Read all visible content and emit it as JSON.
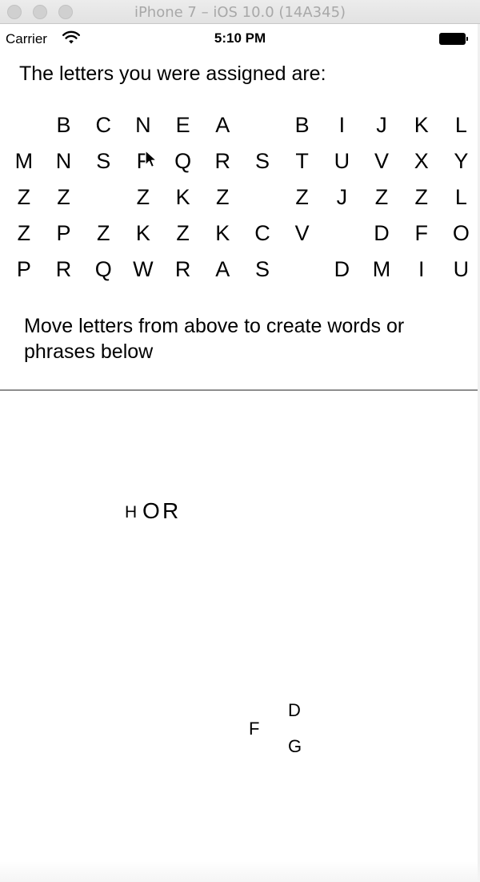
{
  "window": {
    "title": "iPhone 7 – iOS 10.0 (14A345)"
  },
  "statusbar": {
    "carrier": "Carrier",
    "time": "5:10 PM",
    "wifi_icon": "wifi-icon",
    "battery_icon": "battery-icon"
  },
  "assigned": {
    "heading": "The letters you were assigned are:",
    "letters": [
      "",
      "B",
      "C",
      "N",
      "E",
      "A",
      "",
      "B",
      "I",
      "J",
      "K",
      "L",
      "M",
      "N",
      "S",
      "F",
      "Q",
      "R",
      "S",
      "T",
      "U",
      "V",
      "X",
      "Y",
      "Z",
      "Z",
      "",
      "Z",
      "K",
      "Z",
      "",
      "Z",
      "J",
      "Z",
      "Z",
      "L",
      "Z",
      "P",
      "Z",
      "K",
      "Z",
      "K",
      "C",
      "V",
      "",
      "D",
      "F",
      "O",
      "P",
      "R",
      "Q",
      "W",
      "R",
      "A",
      "S",
      "",
      "D",
      "M",
      "I",
      "U"
    ]
  },
  "instructions": "Move letters from above to create words or phrases below",
  "workspace": {
    "placed_letters": [
      {
        "text": "H",
        "size": "small"
      },
      {
        "text": "O",
        "size": "large"
      },
      {
        "text": "R",
        "size": "large"
      },
      {
        "text": "D",
        "size": "medium"
      },
      {
        "text": "F",
        "size": "medium"
      },
      {
        "text": "G",
        "size": "medium"
      }
    ]
  }
}
